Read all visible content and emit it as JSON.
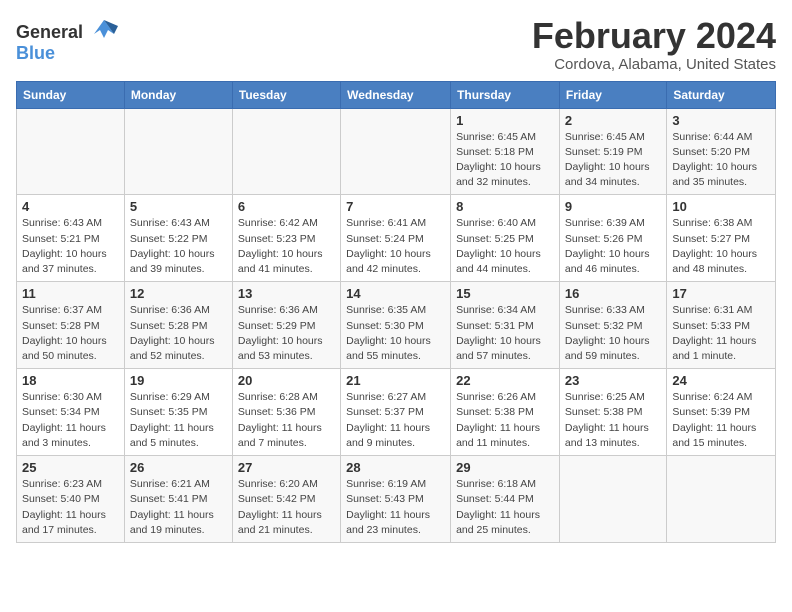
{
  "logo": {
    "text_general": "General",
    "text_blue": "Blue"
  },
  "header": {
    "title": "February 2024",
    "subtitle": "Cordova, Alabama, United States"
  },
  "days_of_week": [
    "Sunday",
    "Monday",
    "Tuesday",
    "Wednesday",
    "Thursday",
    "Friday",
    "Saturday"
  ],
  "weeks": [
    [
      {
        "day": "",
        "info": ""
      },
      {
        "day": "",
        "info": ""
      },
      {
        "day": "",
        "info": ""
      },
      {
        "day": "",
        "info": ""
      },
      {
        "day": "1",
        "info": "Sunrise: 6:45 AM\nSunset: 5:18 PM\nDaylight: 10 hours\nand 32 minutes."
      },
      {
        "day": "2",
        "info": "Sunrise: 6:45 AM\nSunset: 5:19 PM\nDaylight: 10 hours\nand 34 minutes."
      },
      {
        "day": "3",
        "info": "Sunrise: 6:44 AM\nSunset: 5:20 PM\nDaylight: 10 hours\nand 35 minutes."
      }
    ],
    [
      {
        "day": "4",
        "info": "Sunrise: 6:43 AM\nSunset: 5:21 PM\nDaylight: 10 hours\nand 37 minutes."
      },
      {
        "day": "5",
        "info": "Sunrise: 6:43 AM\nSunset: 5:22 PM\nDaylight: 10 hours\nand 39 minutes."
      },
      {
        "day": "6",
        "info": "Sunrise: 6:42 AM\nSunset: 5:23 PM\nDaylight: 10 hours\nand 41 minutes."
      },
      {
        "day": "7",
        "info": "Sunrise: 6:41 AM\nSunset: 5:24 PM\nDaylight: 10 hours\nand 42 minutes."
      },
      {
        "day": "8",
        "info": "Sunrise: 6:40 AM\nSunset: 5:25 PM\nDaylight: 10 hours\nand 44 minutes."
      },
      {
        "day": "9",
        "info": "Sunrise: 6:39 AM\nSunset: 5:26 PM\nDaylight: 10 hours\nand 46 minutes."
      },
      {
        "day": "10",
        "info": "Sunrise: 6:38 AM\nSunset: 5:27 PM\nDaylight: 10 hours\nand 48 minutes."
      }
    ],
    [
      {
        "day": "11",
        "info": "Sunrise: 6:37 AM\nSunset: 5:28 PM\nDaylight: 10 hours\nand 50 minutes."
      },
      {
        "day": "12",
        "info": "Sunrise: 6:36 AM\nSunset: 5:28 PM\nDaylight: 10 hours\nand 52 minutes."
      },
      {
        "day": "13",
        "info": "Sunrise: 6:36 AM\nSunset: 5:29 PM\nDaylight: 10 hours\nand 53 minutes."
      },
      {
        "day": "14",
        "info": "Sunrise: 6:35 AM\nSunset: 5:30 PM\nDaylight: 10 hours\nand 55 minutes."
      },
      {
        "day": "15",
        "info": "Sunrise: 6:34 AM\nSunset: 5:31 PM\nDaylight: 10 hours\nand 57 minutes."
      },
      {
        "day": "16",
        "info": "Sunrise: 6:33 AM\nSunset: 5:32 PM\nDaylight: 10 hours\nand 59 minutes."
      },
      {
        "day": "17",
        "info": "Sunrise: 6:31 AM\nSunset: 5:33 PM\nDaylight: 11 hours\nand 1 minute."
      }
    ],
    [
      {
        "day": "18",
        "info": "Sunrise: 6:30 AM\nSunset: 5:34 PM\nDaylight: 11 hours\nand 3 minutes."
      },
      {
        "day": "19",
        "info": "Sunrise: 6:29 AM\nSunset: 5:35 PM\nDaylight: 11 hours\nand 5 minutes."
      },
      {
        "day": "20",
        "info": "Sunrise: 6:28 AM\nSunset: 5:36 PM\nDaylight: 11 hours\nand 7 minutes."
      },
      {
        "day": "21",
        "info": "Sunrise: 6:27 AM\nSunset: 5:37 PM\nDaylight: 11 hours\nand 9 minutes."
      },
      {
        "day": "22",
        "info": "Sunrise: 6:26 AM\nSunset: 5:38 PM\nDaylight: 11 hours\nand 11 minutes."
      },
      {
        "day": "23",
        "info": "Sunrise: 6:25 AM\nSunset: 5:38 PM\nDaylight: 11 hours\nand 13 minutes."
      },
      {
        "day": "24",
        "info": "Sunrise: 6:24 AM\nSunset: 5:39 PM\nDaylight: 11 hours\nand 15 minutes."
      }
    ],
    [
      {
        "day": "25",
        "info": "Sunrise: 6:23 AM\nSunset: 5:40 PM\nDaylight: 11 hours\nand 17 minutes."
      },
      {
        "day": "26",
        "info": "Sunrise: 6:21 AM\nSunset: 5:41 PM\nDaylight: 11 hours\nand 19 minutes."
      },
      {
        "day": "27",
        "info": "Sunrise: 6:20 AM\nSunset: 5:42 PM\nDaylight: 11 hours\nand 21 minutes."
      },
      {
        "day": "28",
        "info": "Sunrise: 6:19 AM\nSunset: 5:43 PM\nDaylight: 11 hours\nand 23 minutes."
      },
      {
        "day": "29",
        "info": "Sunrise: 6:18 AM\nSunset: 5:44 PM\nDaylight: 11 hours\nand 25 minutes."
      },
      {
        "day": "",
        "info": ""
      },
      {
        "day": "",
        "info": ""
      }
    ]
  ]
}
